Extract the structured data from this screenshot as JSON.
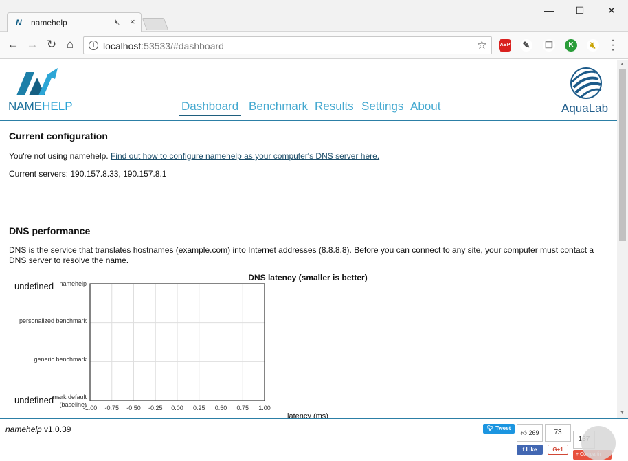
{
  "window": {
    "tab_title": "namehelp",
    "tab_favicon": "N",
    "minimize": "—",
    "maximize": "☐",
    "close": "✕"
  },
  "toolbar": {
    "url_host": "localhost",
    "url_rest": ":53533/#dashboard",
    "extensions": [
      {
        "name": "adblock-icon",
        "text": "ABP",
        "color": "#d9201e"
      },
      {
        "name": "extension-icon-2",
        "text": "",
        "color": "#666"
      },
      {
        "name": "extension-icon-3",
        "text": "",
        "color": "#999"
      },
      {
        "name": "extension-icon-4",
        "text": "K",
        "color": "#2a9d3a"
      },
      {
        "name": "extension-icon-5",
        "text": "",
        "color": "#c9a300"
      }
    ]
  },
  "header": {
    "logo_text_a": "NAME",
    "logo_text_b": "HELP",
    "nav": [
      "Dashboard",
      "Benchmark",
      "Results",
      "Settings",
      "About"
    ],
    "active_nav": "Dashboard",
    "partner_label": "AquaLab"
  },
  "config": {
    "heading": "Current configuration",
    "status_prefix": "You're not using namehelp.",
    "status_link": "Find out how to configure namehelp as your computer's DNS server here.",
    "servers_label": "Current servers: 190.157.8.33, 190.157.8.1"
  },
  "dns": {
    "heading": "DNS performance",
    "description": "DNS is the service that translates hostnames (example.com) into Internet addresses (8.8.8.8). Before you can connect to any site, your computer must contact a DNS server to resolve the name."
  },
  "chart_data": {
    "type": "bar",
    "title": "DNS latency (smaller is better)",
    "xlabel": "latency (ms)",
    "ylabel": "",
    "categories": [
      "namehelp",
      "personalized benchmark",
      "generic benchmark",
      "benchmark default (baseline)"
    ],
    "category_labels_shown": [
      "namehelp",
      "personalized benchmark",
      "generic benchmark",
      "mark default",
      "(baseline)"
    ],
    "values": [
      null,
      null,
      null,
      null
    ],
    "value_labels": [
      "undefined",
      "undefined"
    ],
    "x_ticks": [
      "-1.00",
      "-0.75",
      "-0.50",
      "-0.25",
      "0.00",
      "0.25",
      "0.50",
      "0.75",
      "1.00"
    ],
    "xlim": [
      -1,
      1
    ],
    "grid": true
  },
  "footer": {
    "app_name": "namehelp",
    "version": " v1.0.39",
    "tweet": "Tweet",
    "like_count": "269",
    "like": "Like",
    "gplus_count": "73",
    "gplus": "G+1",
    "share_count": "137",
    "share": "Compartir"
  }
}
